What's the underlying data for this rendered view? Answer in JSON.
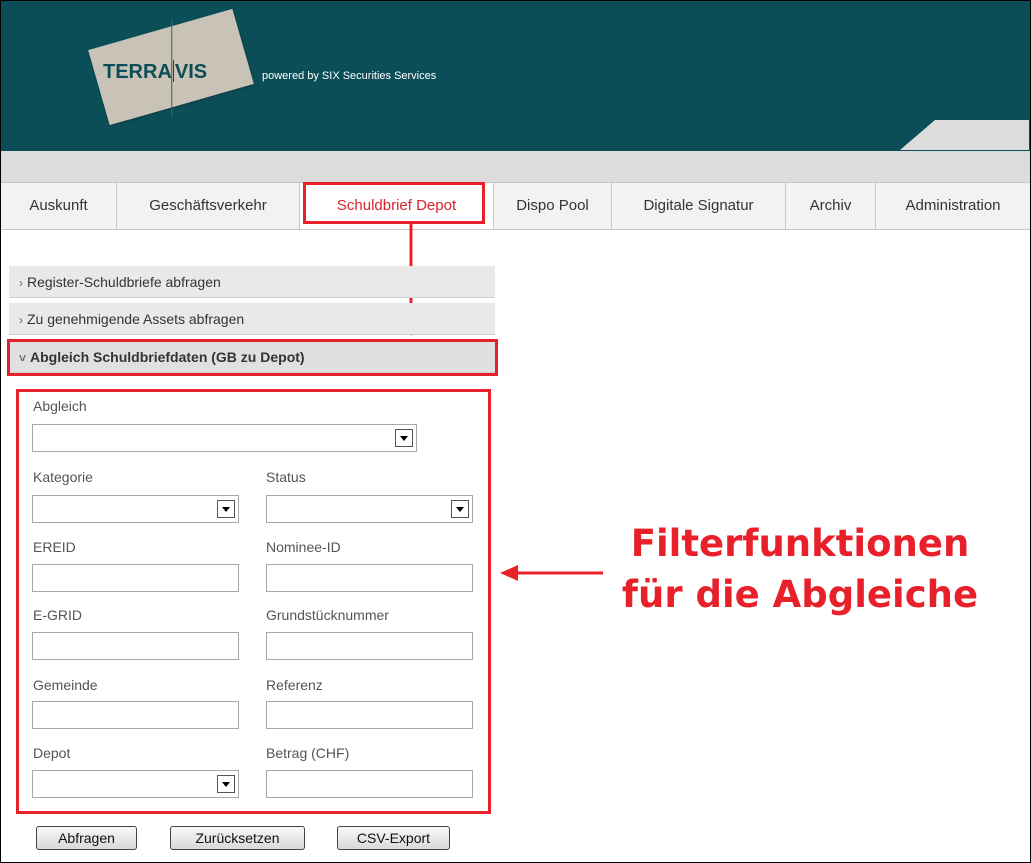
{
  "header": {
    "logo_text_left": "TERRA",
    "logo_text_right": "VIS",
    "powered_by": "powered by SIX Securities Services"
  },
  "nav": {
    "items": [
      {
        "label": "Auskunft"
      },
      {
        "label": "Geschäftsverkehr"
      },
      {
        "label": "Schuldbrief Depot",
        "active": true
      },
      {
        "label": "Dispo Pool"
      },
      {
        "label": "Digitale Signatur"
      },
      {
        "label": "Archiv"
      },
      {
        "label": "Administration"
      }
    ]
  },
  "accordion": {
    "items": [
      {
        "label": "Register-Schuldbriefe abfragen",
        "icon": "chevron-right-icon",
        "chevron": "›"
      },
      {
        "label": "Zu genehmigende Assets abfragen",
        "icon": "chevron-right-icon",
        "chevron": "›"
      },
      {
        "label": "Abgleich Schuldbriefdaten (GB zu Depot)",
        "icon": "chevron-down-icon",
        "chevron": "˅",
        "open": true
      }
    ]
  },
  "filter": {
    "abgleich_label": "Abgleich",
    "kategorie_label": "Kategorie",
    "status_label": "Status",
    "ereid_label": "EREID",
    "nominee_label": "Nominee-ID",
    "egrid_label": "E-GRID",
    "grundstueck_label": "Grundstücknummer",
    "gemeinde_label": "Gemeinde",
    "referenz_label": "Referenz",
    "depot_label": "Depot",
    "betrag_label": "Betrag (CHF)"
  },
  "buttons": {
    "query": "Abfragen",
    "reset": "Zurücksetzen",
    "export": "CSV-Export"
  },
  "annotation": {
    "line1": "Filterfunktionen",
    "line2": "für die Abgleiche"
  },
  "colors": {
    "header_bg": "#0c4e58",
    "highlight": "#e8202a",
    "active_nav_text": "#d8232a"
  }
}
